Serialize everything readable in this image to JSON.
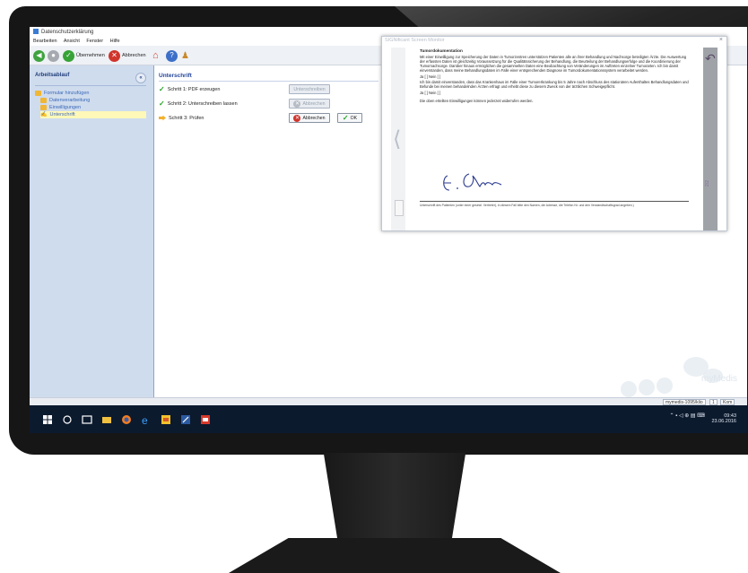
{
  "app": {
    "title": "Datenschutzerklärung",
    "menu": [
      "Bearbeiten",
      "Ansicht",
      "Fenster",
      "Hilfe"
    ],
    "toolbar": {
      "accept_label": "Übernehmen",
      "cancel_label": "Abbrechen"
    }
  },
  "sidebar": {
    "header": "Arbeitsablauf",
    "collapse_symbol": "«",
    "items": [
      {
        "label": "Formular hinzufügen",
        "selected": false
      },
      {
        "label": "Datenverarbeitung",
        "selected": false
      },
      {
        "label": "Einwilligungen",
        "selected": false
      },
      {
        "label": "Unterschrift",
        "selected": true
      }
    ]
  },
  "main": {
    "title": "Unterschrift",
    "steps": [
      {
        "label": "Schritt 1: PDF erzeugen",
        "status": "done"
      },
      {
        "label": "Schritt 2: Unterschreiben lassen",
        "status": "done"
      },
      {
        "label": "Schritt 3: Prüfen",
        "status": "current"
      }
    ],
    "buttons": {
      "sign": "Unterschreiben",
      "cancel_disabled": "Abbrechen",
      "cancel": "Abbrechen",
      "ok": "OK"
    },
    "watermark": "myMedis"
  },
  "modal": {
    "title": "SIGNificant Screen Monitor",
    "close_symbol": "×",
    "doc": {
      "heading": "Tumordokumentation",
      "para1": "Mit einer Einwilligung zur Speicherung der Daten in Tumorzentren unterstützen Patienten alle an ihrer Behandlung und Nachsorge beteiligten Ärzte. Die Auswertung der erfassten Daten ist gleichzeitig Voraussetzung für die Qualitätssicherung der Behandlung, die Beurteilung der Behandlungserfolge und die Koordinierung der Tumornachsorge. Darüber hinaus ermöglichen die gesammelten Daten eine Beobachtung von Veränderungen im Auftreten einzelner Tumorarten. Ich bin damit einverstanden, dass meine Behandlungsdaten im Falle einer entsprechenden Diagnose im Tumordokumentationssystem verarbeitet werden.",
      "choice1": "Ja [ ]          Nein [ ]",
      "para2": "Ich bin damit einverstanden, dass das Krankenhaus im Falle einer Tumorerkrankung bis 5 Jahre nach Abschluss des stationären Aufenthaltes Behandlungsdaten und Befunde bei meinen behandelnden Ärzten erfragt und erhebt diese zu diesem Zweck von der ärztlichen Schweigepflicht.",
      "choice2": "Ja [ ]          Nein [ ]",
      "para3": "Die oben erteilten Einwilligungen können jederzeit widerrufen werden.",
      "signature_caption": "Unterschrift des Patienten (unter einer gesetzl. Vertreter), in diesem Fall bitte den Namen, die Adresse, die Telefon Nr. und den Verwandtschaftsgrad angeben.)"
    },
    "page_indicator": "2/2"
  },
  "status": {
    "user": "mymedis-1095/klio",
    "count": "1",
    "mode": "Kom"
  },
  "taskbar": {
    "time": "09:43",
    "date": "23.06.2016"
  },
  "colors": {
    "accent": "#23449a",
    "sidebar_bg": "#cfdcee",
    "selected_bg": "#fff8b8",
    "taskbar": "#0c1a2e"
  }
}
